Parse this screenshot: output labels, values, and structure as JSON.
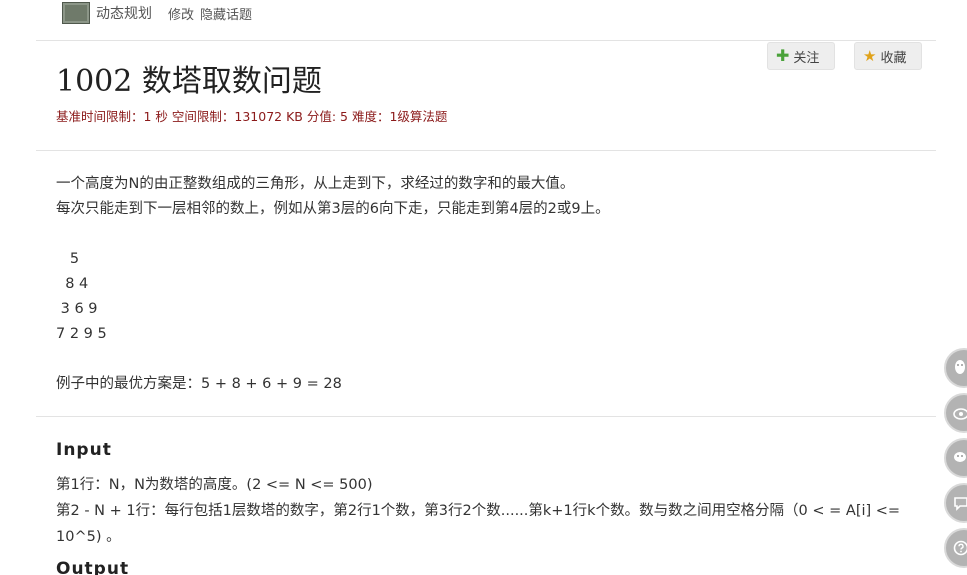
{
  "breadcrumb": {
    "category": "动态规划",
    "edit": "修改",
    "hide_topic": "隐藏话题"
  },
  "problem": {
    "title": "1002 数塔取数问题",
    "meta": "基准时间限制：1 秒 空间限制：131072 KB 分值: 5 难度：1级算法题"
  },
  "actions": {
    "follow_label": "关注",
    "favorite_label": "收藏"
  },
  "description": {
    "lines": [
      "一个高度为N的由正整数组成的三角形，从上走到下，求经过的数字和的最大值。",
      "每次只能走到下一层相邻的数上，例如从第3层的6向下走，只能走到第4层的2或9上。",
      "",
      "   5",
      "  8 4",
      " 3 6 9",
      "7 2 9 5",
      "",
      "例子中的最优方案是：5 + 8 + 6 + 9 = 28"
    ]
  },
  "input": {
    "heading": "Input",
    "lines": [
      "第1行：N，N为数塔的高度。(2 <= N <= 500)",
      "第2 - N + 1行：每行包括1层数塔的数字，第2行1个数，第3行2个数......第k+1行k个数。数与数之间用空格分隔（0 < = A[i] <= 10^5) 。"
    ]
  },
  "output": {
    "heading": "Output"
  },
  "side_tools": [
    "qq-icon",
    "weibo-icon",
    "wechat-icon",
    "comment-icon",
    "help-icon"
  ]
}
